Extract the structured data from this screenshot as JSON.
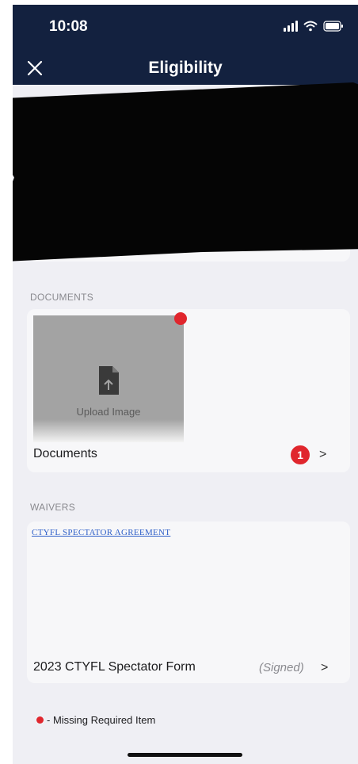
{
  "status_bar": {
    "time": "10:08"
  },
  "nav": {
    "title": "Eligibility"
  },
  "documents": {
    "section_label": "DOCUMENTS",
    "upload_label": "Upload Image",
    "row_label": "Documents",
    "badge_count": "1",
    "chevron": ">"
  },
  "waivers": {
    "section_label": "WAIVERS",
    "link_text": "CTYFL SPECTATOR AGREEMENT",
    "row_label": "2023 CTYFL Spectator Form",
    "status": "(Signed)",
    "chevron": ">"
  },
  "legend": {
    "text": "- Missing Required Item"
  },
  "colors": {
    "nav_bg": "#13213f",
    "alert_red": "#e0262d",
    "link_blue": "#2e5fc8",
    "page_bg": "#efeff4"
  }
}
